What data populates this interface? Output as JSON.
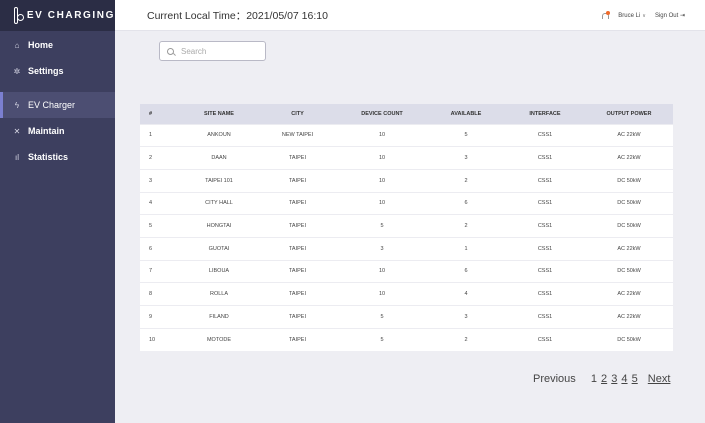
{
  "brand": {
    "name": "EV CHARGING"
  },
  "sidebar": {
    "items": [
      {
        "label": "Home",
        "icon": "home-icon",
        "glyph": "⌂",
        "active": false
      },
      {
        "label": "Settings",
        "icon": "gear-icon",
        "glyph": "✲",
        "active": false
      },
      {
        "label": "EV Charger",
        "icon": "bolt-icon",
        "glyph": "ϟ",
        "active": true
      },
      {
        "label": "Maintain",
        "icon": "tools-icon",
        "glyph": "✕",
        "active": false
      },
      {
        "label": "Statistics",
        "icon": "bar-chart-icon",
        "glyph": "ıl",
        "active": false
      }
    ]
  },
  "header": {
    "time_label": "Current Local Time：2021/05/07 16:10",
    "user": "Bruce Li",
    "sign_out": "Sign Out ⇥"
  },
  "search": {
    "placeholder": "Search"
  },
  "table": {
    "columns": [
      "#",
      "SITE NAME",
      "CITY",
      "DEVICE COUNT",
      "AVAILABLE",
      "INTERFACE",
      "OUTPUT POWER"
    ],
    "rows": [
      [
        "1",
        "ANKOUN",
        "NEW TAIPEI",
        "10",
        "5",
        "CSS1",
        "AC 22kW"
      ],
      [
        "2",
        "DAAN",
        "TAIPEI",
        "10",
        "3",
        "CSS1",
        "AC 22kW"
      ],
      [
        "3",
        "TAIPEI 101",
        "TAIPEI",
        "10",
        "2",
        "CSS1",
        "DC 50kW"
      ],
      [
        "4",
        "CITY HALL",
        "TAIPEI",
        "10",
        "6",
        "CSS1",
        "DC 50kW"
      ],
      [
        "5",
        "HONGTAI",
        "TAIPEI",
        "5",
        "2",
        "CSS1",
        "DC 50kW"
      ],
      [
        "6",
        "GUOTAI",
        "TAIPEI",
        "3",
        "1",
        "CSS1",
        "AC 22kW"
      ],
      [
        "7",
        "LIBOUA",
        "TAIPEI",
        "10",
        "6",
        "CSS1",
        "DC 50kW"
      ],
      [
        "8",
        "ROLLA",
        "TAIPEI",
        "10",
        "4",
        "CSS1",
        "AC 22kW"
      ],
      [
        "9",
        "FILAND",
        "TAIPEI",
        "5",
        "3",
        "CSS1",
        "AC 22kW"
      ],
      [
        "10",
        "MOTODE",
        "TAIPEI",
        "5",
        "2",
        "CSS1",
        "DC 50kW"
      ]
    ]
  },
  "pagination": {
    "previous": "Previous",
    "pages": [
      "1",
      "2",
      "3",
      "4",
      "5"
    ],
    "current": "1",
    "next": "Next"
  },
  "colors": {
    "sidebar": "#3d3f5f",
    "brand_bar": "#2b2d45",
    "active_item": "#4c4e72",
    "accent": "#7b7fd0",
    "notification": "#f06a2a"
  }
}
